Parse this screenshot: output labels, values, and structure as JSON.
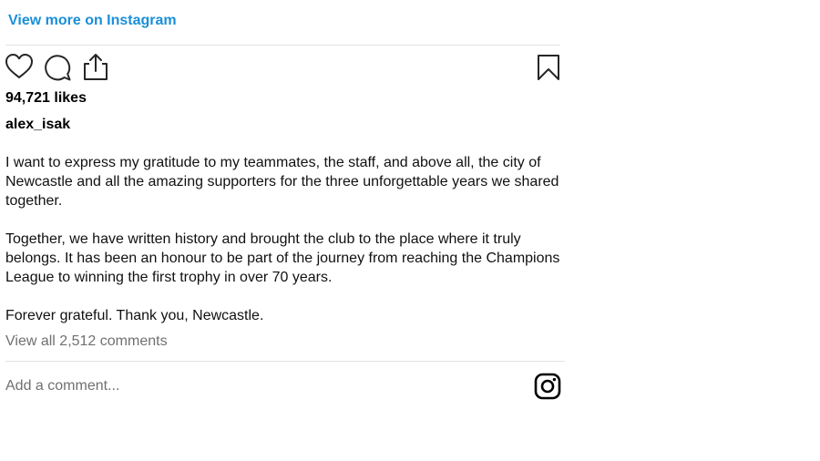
{
  "header": {
    "view_more": "View more on Instagram"
  },
  "actions": {
    "like_icon": "heart-icon",
    "comment_icon": "comment-icon",
    "share_icon": "share-icon",
    "save_icon": "bookmark-icon"
  },
  "post": {
    "likes": "94,721 likes",
    "username": "alex_isak",
    "caption": [
      "I want to express my gratitude to my teammates, the staff, and above all, the city of Newcastle and all the amazing supporters for the three unforgettable years we shared together.",
      "Together, we have written history and brought the club to the place where it truly belongs. It has been an honour to be part of the journey from reaching the Champions League to winning the first trophy in over 70 years.",
      "Forever grateful. Thank you, Newcastle."
    ],
    "comments_link": "View all 2,512 comments"
  },
  "footer": {
    "add_comment": "Add a comment...",
    "logo_icon": "instagram-logo-icon"
  },
  "colors": {
    "link": "#1a8fd8",
    "muted": "#707070",
    "divider": "#e2e2e2"
  }
}
